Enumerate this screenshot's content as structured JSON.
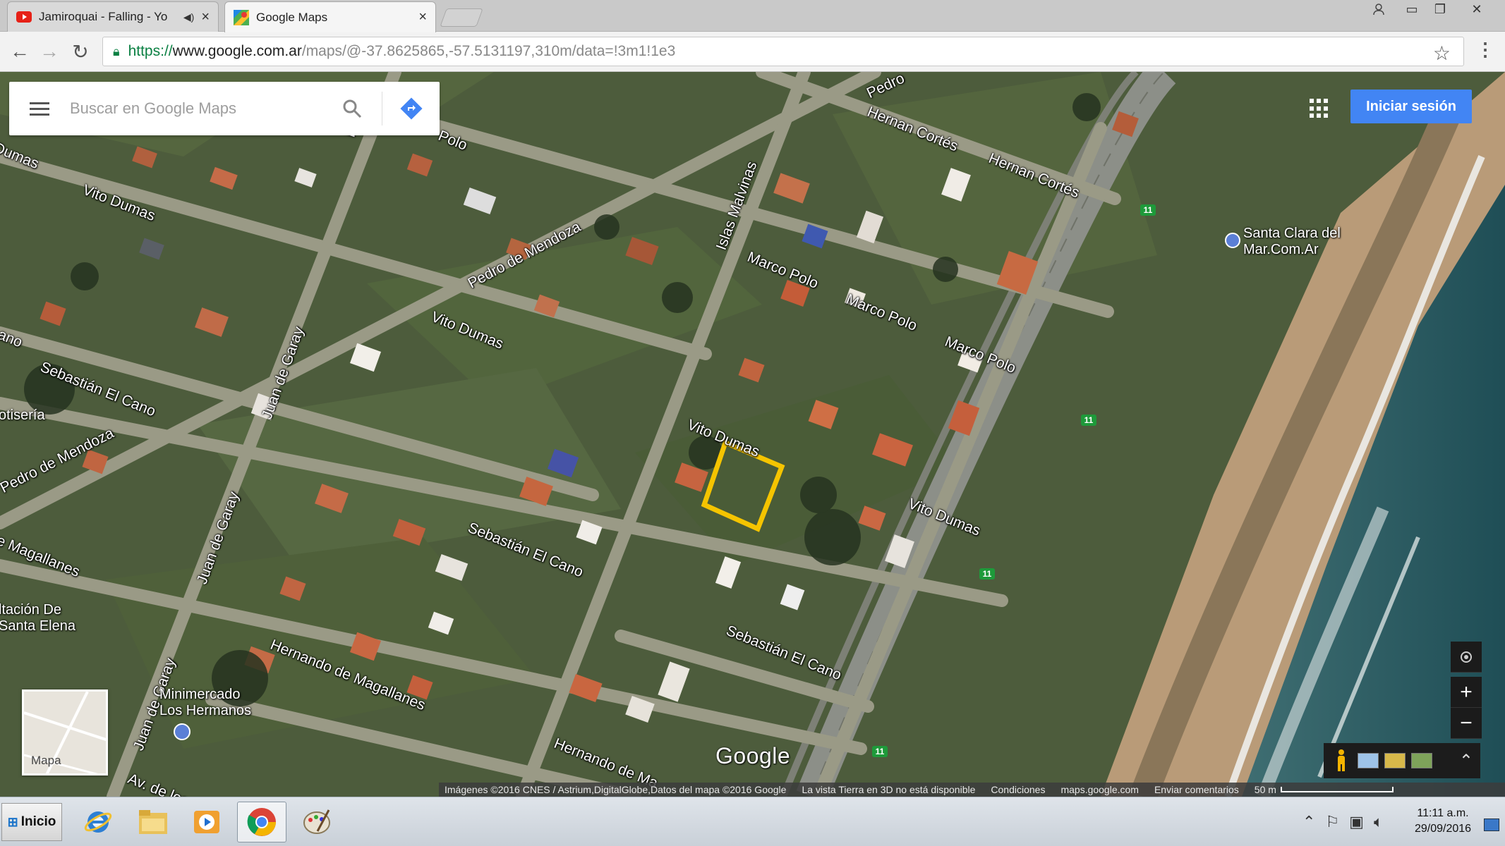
{
  "browser": {
    "tabs": [
      {
        "title": "Jamiroquai - Falling - Yo",
        "favicon": "youtube-icon",
        "audio": true
      },
      {
        "title": "Google Maps",
        "favicon": "google-maps-icon",
        "active": true
      }
    ],
    "url": {
      "scheme": "https://",
      "host": "www.google.com.ar",
      "path": "/maps/@-37.8625865,-57.5131197,310m/data=!3m1!1e3"
    }
  },
  "maps": {
    "search_placeholder": "Buscar en Google Maps",
    "signin_label": "Iniciar sesión",
    "minimap_label": "Mapa",
    "logo": "Google",
    "streets": [
      {
        "name": "Vito Dumas"
      },
      {
        "name": "Dumas"
      },
      {
        "name": "Pedro de Mendoza"
      },
      {
        "name": "Pedro de Mendoza"
      },
      {
        "name": "Islas Malvinas"
      },
      {
        "name": "Hernan Cortés"
      },
      {
        "name": "Hernan Cortés"
      },
      {
        "name": "Marco Polo"
      },
      {
        "name": "Marco Polo"
      },
      {
        "name": "Marco Polo"
      },
      {
        "name": "Polo"
      },
      {
        "name": "Vito Dumas"
      },
      {
        "name": "Vito Dumas"
      },
      {
        "name": "Vito Dumas"
      },
      {
        "name": "Juan de Garay"
      },
      {
        "name": "Juan de Garay"
      },
      {
        "name": "Juan de Garay"
      },
      {
        "name": "Sebastián El Cano"
      },
      {
        "name": "Sebastián El Cano"
      },
      {
        "name": "Sebastián El Cano"
      },
      {
        "name": "Hernando de Magallanes"
      },
      {
        "name": "Hernando de Ma"
      },
      {
        "name": "e Magallanes"
      },
      {
        "name": "Av. de los"
      },
      {
        "name": "ano"
      },
      {
        "name": "Pedro"
      },
      {
        "name": "Pedro"
      }
    ],
    "pois": [
      {
        "name": "Santa Clara del\nMar.Com.Ar"
      },
      {
        "name": "Minimercado\nLos Hermanos"
      },
      {
        "name": "otisería"
      },
      {
        "name": "ltación De\nSanta Elena"
      }
    ],
    "route_shield": "11",
    "attribution": {
      "imagery": "Imágenes ©2016 CNES / Astrium,DigitalGlobe,Datos del mapa ©2016 Google",
      "earth": "La vista Tierra en 3D no está disponible",
      "terms": "Condiciones",
      "site": "maps.google.com",
      "feedback": "Enviar comentarios",
      "scale": "50 m"
    },
    "colors": {
      "signin": "#4285f4",
      "highlight_parcel": "#f5c400",
      "route_shield": "#1e9a3a"
    }
  },
  "taskbar": {
    "start_label": "Inicio",
    "apps": [
      "internet-explorer-icon",
      "file-explorer-icon",
      "media-player-icon",
      "chrome-icon",
      "paint-icon"
    ],
    "clock_time": "11:11 a.m.",
    "clock_date": "29/09/2016"
  }
}
